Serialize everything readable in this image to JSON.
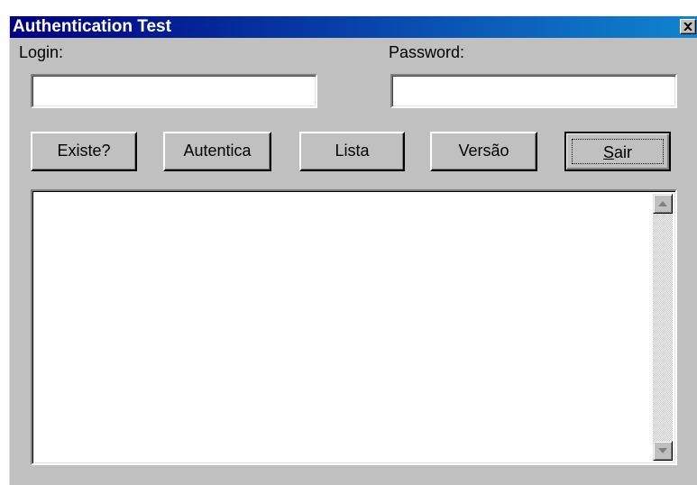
{
  "window": {
    "title": "Authentication Test"
  },
  "form": {
    "login_label": "Login:",
    "login_value": "",
    "password_label": "Password:",
    "password_value": ""
  },
  "buttons": {
    "existe": "Existe?",
    "autentica": "Autentica",
    "lista": "Lista",
    "versao": "Versão",
    "sair_accel": "S",
    "sair_rest": "air"
  },
  "output": {
    "text": ""
  },
  "icons": {
    "close": "close-icon",
    "scroll_up": "arrow-up-icon",
    "scroll_down": "arrow-down-icon"
  },
  "colors": {
    "title_start": "#000080",
    "title_end": "#1084d0",
    "face": "#c0c0c0"
  }
}
